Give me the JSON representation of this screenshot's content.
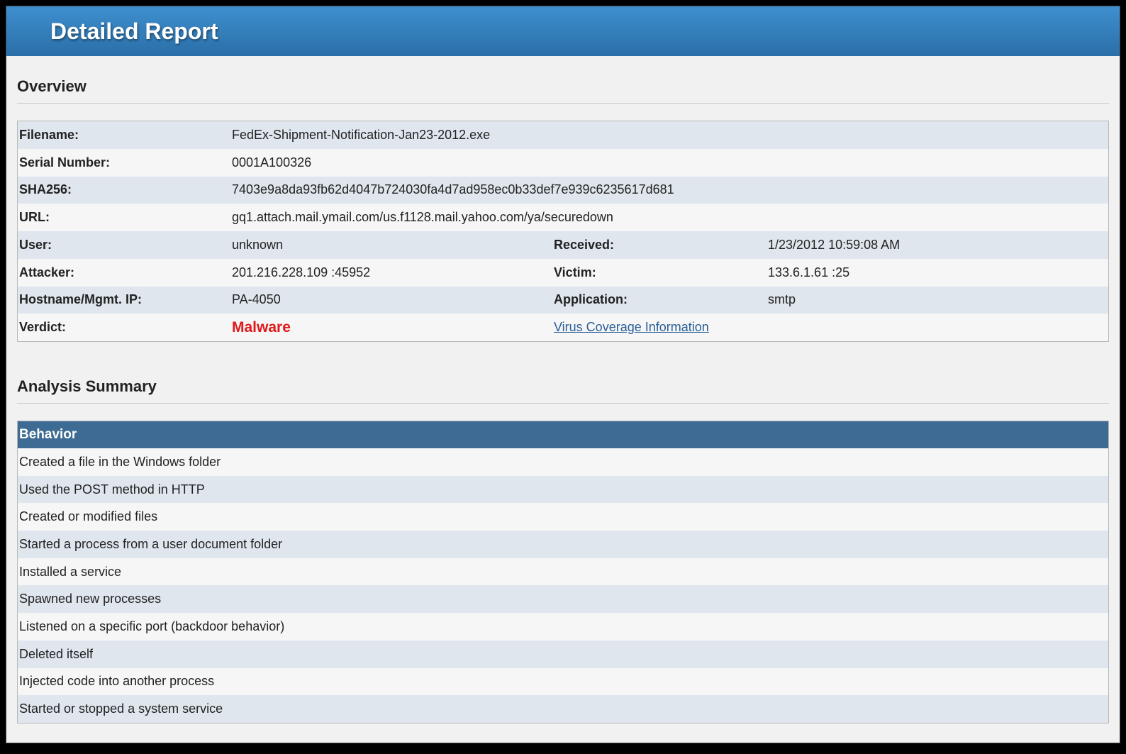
{
  "window": {
    "title": "Detailed Report"
  },
  "overview": {
    "heading": "Overview",
    "filename_label": "Filename:",
    "filename": "FedEx-Shipment-Notification-Jan23-2012.exe",
    "serial_label": "Serial Number:",
    "serial": "0001A100326",
    "sha_label": "SHA256:",
    "sha": "7403e9a8da93fb62d4047b724030fa4d7ad958ec0b33def7e939c6235617d681",
    "url_label": "URL:",
    "url": "gq1.attach.mail.ymail.com/us.f1128.mail.yahoo.com/ya/securedown",
    "user_label": "User:",
    "user": "unknown",
    "received_label": "Received:",
    "received": "1/23/2012 10:59:08 AM",
    "attacker_label": "Attacker:",
    "attacker": "201.216.228.109 :45952",
    "victim_label": "Victim:",
    "victim": "133.6.1.61 :25",
    "hostname_label": "Hostname/Mgmt. IP:",
    "hostname": "PA-4050",
    "application_label": "Application:",
    "application": "smtp",
    "verdict_label": "Verdict:",
    "verdict": "Malware",
    "coverage_link": "Virus Coverage Information"
  },
  "analysis": {
    "heading": "Analysis Summary",
    "behavior_header": "Behavior",
    "behaviors": [
      "Created a file in the Windows folder",
      "Used the POST method in HTTP",
      "Created or modified files",
      "Started a process from a user document folder",
      "Installed a service",
      "Spawned new processes",
      "Listened on a specific port (backdoor behavior)",
      "Deleted itself",
      "Injected code into another process",
      "Started or stopped a system service"
    ]
  },
  "colors": {
    "header": "#2a6fa8",
    "verdict": "#e0191b",
    "behavior_header": "#3d6b93"
  }
}
